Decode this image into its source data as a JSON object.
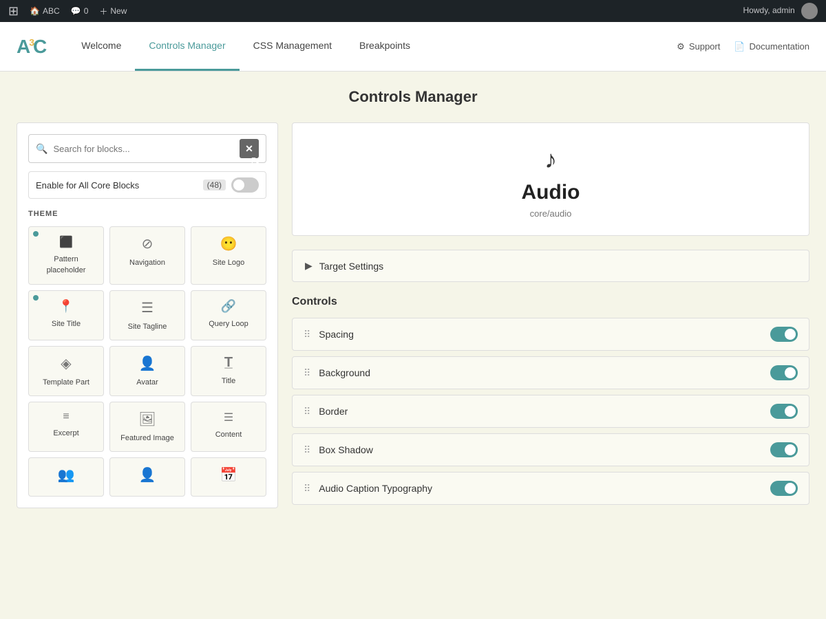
{
  "adminBar": {
    "wpLogo": "⊞",
    "siteLabel": "ABC",
    "commentCount": "0",
    "newLabel": "New",
    "howdy": "Howdy, admin"
  },
  "pluginNav": {
    "logo": "A³C",
    "tabs": [
      {
        "id": "welcome",
        "label": "Welcome",
        "active": false
      },
      {
        "id": "controls-manager",
        "label": "Controls Manager",
        "active": true
      },
      {
        "id": "css-management",
        "label": "CSS Management",
        "active": false
      },
      {
        "id": "breakpoints",
        "label": "Breakpoints",
        "active": false
      }
    ],
    "rightLinks": [
      {
        "id": "support",
        "label": "Support",
        "icon": "⚙"
      },
      {
        "id": "documentation",
        "label": "Documentation",
        "icon": "📄"
      }
    ]
  },
  "page": {
    "title": "Controls Manager"
  },
  "leftPanel": {
    "searchPlaceholder": "Search for blocks...",
    "enableAllLabel": "Enable for All Core Blocks",
    "countBadge": "(48)",
    "sectionLabel": "THEME",
    "blocks": [
      {
        "id": "pattern-placeholder",
        "name": "Pattern placeholder",
        "icon": "⬛",
        "dotted": true
      },
      {
        "id": "navigation",
        "name": "Navigation",
        "icon": "⊘",
        "dotted": false
      },
      {
        "id": "site-logo",
        "name": "Site Logo",
        "icon": "☺",
        "dotted": false
      },
      {
        "id": "site-title",
        "name": "Site Title",
        "icon": "📍",
        "dotted": true
      },
      {
        "id": "site-tagline",
        "name": "Site Tagline",
        "icon": "☰",
        "dotted": false
      },
      {
        "id": "query-loop",
        "name": "Query Loop",
        "icon": "🔗",
        "dotted": false
      },
      {
        "id": "template-part",
        "name": "Template Part",
        "icon": "◈",
        "dotted": false
      },
      {
        "id": "avatar",
        "name": "Avatar",
        "icon": "👤",
        "dotted": false
      },
      {
        "id": "title",
        "name": "Title",
        "icon": "T",
        "dotted": false
      },
      {
        "id": "excerpt",
        "name": "Excerpt",
        "icon": "≡",
        "dotted": false
      },
      {
        "id": "featured-image",
        "name": "Featured Image",
        "icon": "🖼",
        "dotted": false
      },
      {
        "id": "content",
        "name": "Content",
        "icon": "☰",
        "dotted": false
      },
      {
        "id": "row1col1",
        "name": "",
        "icon": "👥",
        "dotted": false
      },
      {
        "id": "row1col2",
        "name": "",
        "icon": "👤",
        "dotted": false
      },
      {
        "id": "row1col3",
        "name": "",
        "icon": "📅",
        "dotted": false
      }
    ]
  },
  "rightPanel": {
    "blockIcon": "♪",
    "blockTitle": "Audio",
    "blockSlug": "core/audio",
    "targetSettingsLabel": "Target Settings",
    "controlsTitle": "Controls",
    "controls": [
      {
        "id": "spacing",
        "name": "Spacing",
        "enabled": true
      },
      {
        "id": "background",
        "name": "Background",
        "enabled": true
      },
      {
        "id": "border",
        "name": "Border",
        "enabled": true
      },
      {
        "id": "box-shadow",
        "name": "Box Shadow",
        "enabled": true
      },
      {
        "id": "audio-caption-typography",
        "name": "Audio Caption Typography",
        "enabled": true
      }
    ]
  }
}
